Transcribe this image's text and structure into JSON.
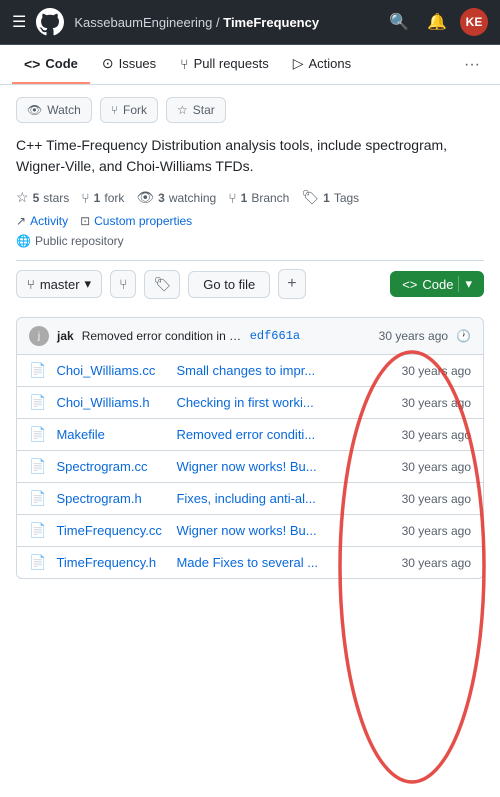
{
  "header": {
    "breadcrumb_user": "KassebaumEngineering /",
    "breadcrumb_repo": "TimeFrequency",
    "hamburger": "☰",
    "search_icon": "🔍",
    "notification_icon": "🔔",
    "avatar_initials": "KE"
  },
  "repo_nav": {
    "items": [
      {
        "label": "Code",
        "icon": "<>",
        "active": true
      },
      {
        "label": "Issues",
        "icon": "⊙"
      },
      {
        "label": "Pull requests",
        "icon": "⑂"
      },
      {
        "label": "Actions",
        "icon": "▷"
      },
      {
        "label": "...",
        "icon": ""
      }
    ]
  },
  "actions_row": {
    "watch_label": "Watch",
    "fork_label": "Fork",
    "star_label": "Star"
  },
  "description": "C++ Time-Frequency Distribution analysis tools, include spectrogram, Wigner-Ville, and Choi-Williams TFDs.",
  "stats": {
    "stars_count": "5",
    "stars_label": "stars",
    "fork_count": "1",
    "fork_label": "fork",
    "watch_count": "3",
    "watch_label": "watching",
    "branch_count": "1",
    "branch_label": "Branch",
    "tag_count": "1",
    "tag_label": "Tags"
  },
  "meta": {
    "activity_label": "Activity",
    "custom_props_label": "Custom properties",
    "public_label": "Public repository"
  },
  "toolbar": {
    "branch_label": "master",
    "go_to_file_label": "Go to file",
    "plus_label": "+",
    "code_label": "Code"
  },
  "commit": {
    "author": "jak",
    "message": "Removed error condition in makefile in...",
    "hash": "edf661a",
    "time": "30 years ago"
  },
  "files": [
    {
      "name": "Choi_Williams.cc",
      "commit_msg": "Small changes to impr...",
      "time": "30 years ago"
    },
    {
      "name": "Choi_Williams.h",
      "commit_msg": "Checking in first worki...",
      "time": "30 years ago"
    },
    {
      "name": "Makefile",
      "commit_msg": "Removed error conditi...",
      "time": "30 years ago"
    },
    {
      "name": "Spectrogram.cc",
      "commit_msg": "Wigner now works! Bu...",
      "time": "30 years ago"
    },
    {
      "name": "Spectrogram.h",
      "commit_msg": "Fixes, including anti-al...",
      "time": "30 years ago"
    },
    {
      "name": "TimeFrequency.cc",
      "commit_msg": "Wigner now works! Bu...",
      "time": "30 years ago"
    },
    {
      "name": "TimeFrequency.h",
      "commit_msg": "Made Fixes to several ...",
      "time": "30 years ago"
    }
  ]
}
